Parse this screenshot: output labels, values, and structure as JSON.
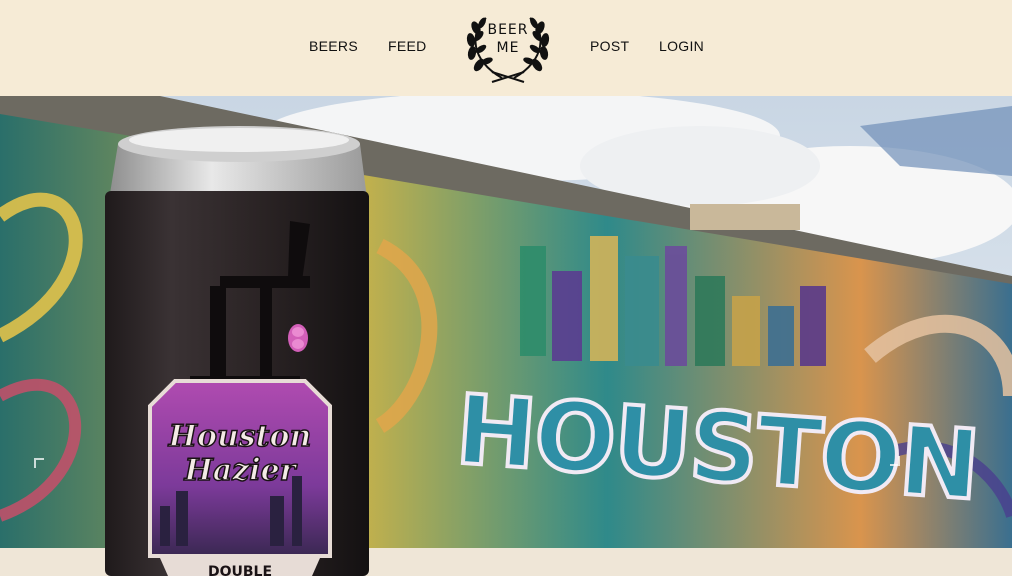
{
  "nav": {
    "beers": "BEERS",
    "feed": "FEED",
    "post": "POST",
    "login": "LOGIN"
  },
  "logo": {
    "line1": "BEER",
    "line2": "ME"
  },
  "hero": {
    "mural_text": "HOUSTON",
    "can_label_line1": "Houston",
    "can_label_line2": "Hazier",
    "can_label_sub": "DOUBLE"
  },
  "colors": {
    "header_bg": "#f6ebd6",
    "text": "#111111"
  }
}
